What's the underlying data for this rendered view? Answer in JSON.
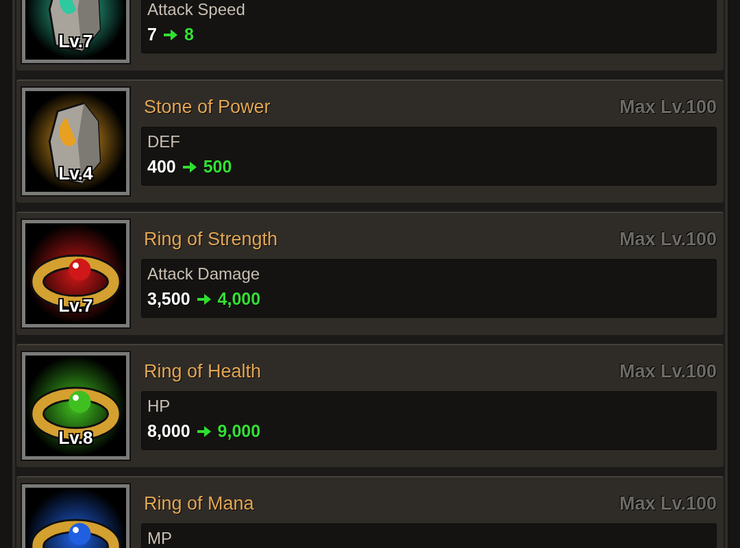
{
  "items": [
    {
      "kind": "stone",
      "color": "#2fc9a0",
      "level_badge": "Lv.7",
      "stat": "Attack Speed",
      "from": "7",
      "to": "8"
    },
    {
      "kind": "stone",
      "color": "#e8a020",
      "name": "Stone of Power",
      "max_level": "Max Lv.100",
      "level_badge": "Lv.4",
      "stat": "DEF",
      "from": "400",
      "to": "500"
    },
    {
      "kind": "ring",
      "color": "#d01818",
      "name": "Ring of Strength",
      "max_level": "Max Lv.100",
      "level_badge": "Lv.7",
      "stat": "Attack Damage",
      "from": "3,500",
      "to": "4,000"
    },
    {
      "kind": "ring",
      "color": "#40c020",
      "name": "Ring of Health",
      "max_level": "Max Lv.100",
      "level_badge": "Lv.8",
      "stat": "HP",
      "from": "8,000",
      "to": "9,000"
    },
    {
      "kind": "ring",
      "color": "#2060e0",
      "name": "Ring of Mana",
      "max_level": "Max Lv.100",
      "stat": "MP"
    }
  ]
}
